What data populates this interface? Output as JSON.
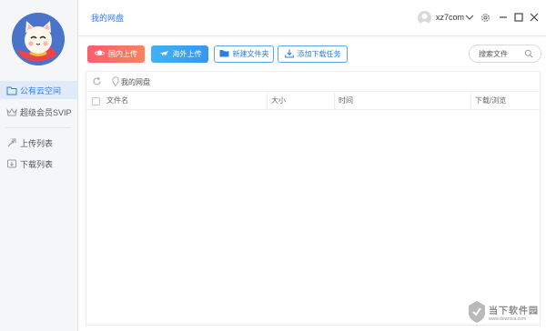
{
  "sidebar": {
    "items": [
      {
        "label": "公有云空间",
        "icon": "folder-icon",
        "active": true
      },
      {
        "label": "超级会员SVIP",
        "icon": "crown-icon",
        "active": false
      },
      {
        "label": "上传列表",
        "icon": "upload-rocket-icon",
        "active": false
      },
      {
        "label": "下载列表",
        "icon": "download-icon",
        "active": false
      }
    ]
  },
  "header": {
    "tab_label": "我的网盘",
    "username": "xz7com"
  },
  "toolbar": {
    "domestic_upload": "国内上传",
    "overseas_upload": "海外上传",
    "new_folder": "新建文件夹",
    "add_download": "添加下载任务"
  },
  "search": {
    "placeholder": "搜索文件"
  },
  "breadcrumb": {
    "root": "我的网盘"
  },
  "table": {
    "columns": [
      "文件名",
      "大小",
      "时间",
      "下载/浏览"
    ]
  },
  "watermark": {
    "text": "当下软件园",
    "sub": "www.downxia.com"
  },
  "colors": {
    "accent": "#2f7de1",
    "domestic_btn": "#ff5d6c",
    "overseas_btn": "#3fa6f5",
    "sidebar_bg": "#f5f6f8",
    "active_item_bg": "#e1eaf8"
  }
}
